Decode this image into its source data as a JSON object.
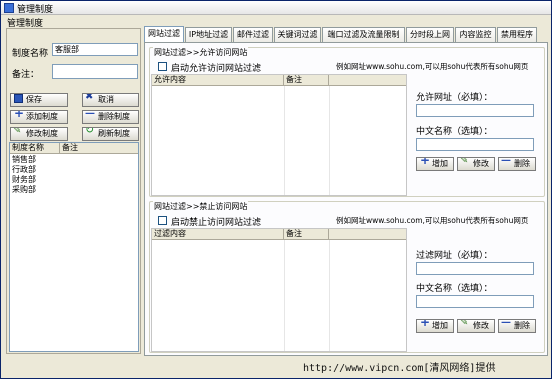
{
  "window": {
    "title": "管理制度",
    "menu": "管理制度"
  },
  "left": {
    "name_label": "制度名称",
    "name_value": "客服部",
    "note_label": "备注：",
    "note_value": "",
    "buttons": {
      "save": "保存",
      "cancel": "取消",
      "add": "添加制度",
      "delete": "删除制度",
      "edit": "修改制度",
      "refresh": "刷新制度"
    },
    "list": {
      "columns": [
        "制度名称",
        "备注"
      ],
      "rows": [
        "销售部",
        "行政部",
        "财务部",
        "采购部"
      ]
    }
  },
  "tabs": [
    "网站过滤",
    "IP地址过滤",
    "邮件过滤",
    "关键词过滤",
    "端口过滤及流量限制",
    "分时段上网",
    "内容监控",
    "禁用程序"
  ],
  "allow": {
    "group_title": "网站过滤>>允许访问网站",
    "checkbox_label": "启动允许访问网站过滤",
    "example": "例如网址www.sohu.com,可以用sohu代表所有sohu网页",
    "columns": [
      "允许内容",
      "备注"
    ],
    "url_label": "允许网址（必填）：",
    "name_label": "中文名称（选填）：",
    "btn_add": "增加",
    "btn_edit": "修改",
    "btn_delete": "删除"
  },
  "block": {
    "group_title": "网站过滤>>禁止访问网站",
    "checkbox_label": "启动禁止访问网站过滤",
    "example": "例如网址www.sohu.com,可以用sohu代表所有sohu网页",
    "columns": [
      "过滤内容",
      "备注"
    ],
    "url_label": "过滤网址（必填）：",
    "name_label": "中文名称（选填）：",
    "btn_add": "增加",
    "btn_edit": "修改",
    "btn_delete": "删除"
  },
  "watermark": "http://www.vipcn.com[清风网络]提供"
}
